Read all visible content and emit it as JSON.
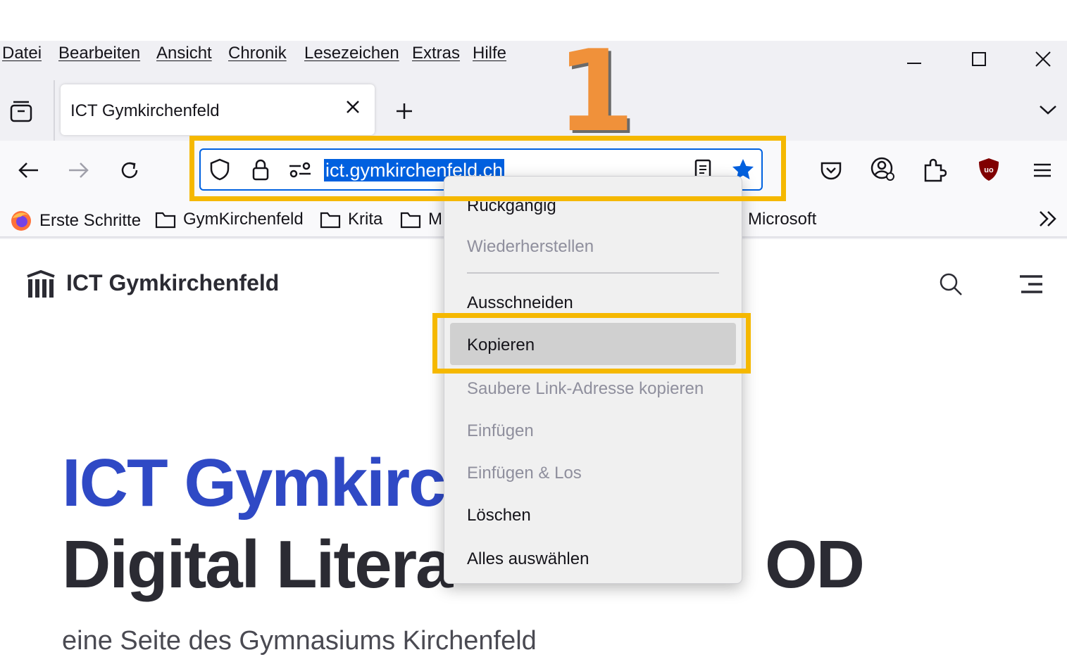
{
  "menubar": {
    "items": [
      "Datei",
      "Bearbeiten",
      "Ansicht",
      "Chronik",
      "Lesezeichen",
      "Extras",
      "Hilfe"
    ]
  },
  "tab": {
    "title": "ICT Gymkirchenfeld"
  },
  "urlbar": {
    "value": "ict.gymkirchenfeld.ch"
  },
  "bookmarks": {
    "items": [
      "Erste Schritte",
      "GymKirchenfeld",
      "Krita",
      "M",
      "Microsoft"
    ]
  },
  "context_menu": {
    "items": [
      {
        "label": "Rückgängig",
        "enabled": true
      },
      {
        "label": "Wiederherstellen",
        "enabled": false
      },
      {
        "label": "Ausschneiden",
        "enabled": true
      },
      {
        "label": "Kopieren",
        "enabled": true,
        "hovered": true
      },
      {
        "label": "Saubere Link-Adresse kopieren",
        "enabled": false
      },
      {
        "label": "Einfügen",
        "enabled": false
      },
      {
        "label": "Einfügen & Los",
        "enabled": false
      },
      {
        "label": "Löschen",
        "enabled": true
      },
      {
        "label": "Alles auswählen",
        "enabled": true
      }
    ]
  },
  "annotation": {
    "step": "1"
  },
  "page": {
    "site_name": "ICT Gymkirchenfeld",
    "hero_line1": "ICT Gymkirc",
    "hero_line2": "Digital Litera",
    "hero_line2_tail": "OD",
    "subtitle": "eine Seite des Gymnasiums Kirchenfeld"
  },
  "colors": {
    "accent": "#0060df",
    "highlight": "#f5b800",
    "step_number": "#f0913a",
    "hero_blue": "#2f49c5"
  }
}
